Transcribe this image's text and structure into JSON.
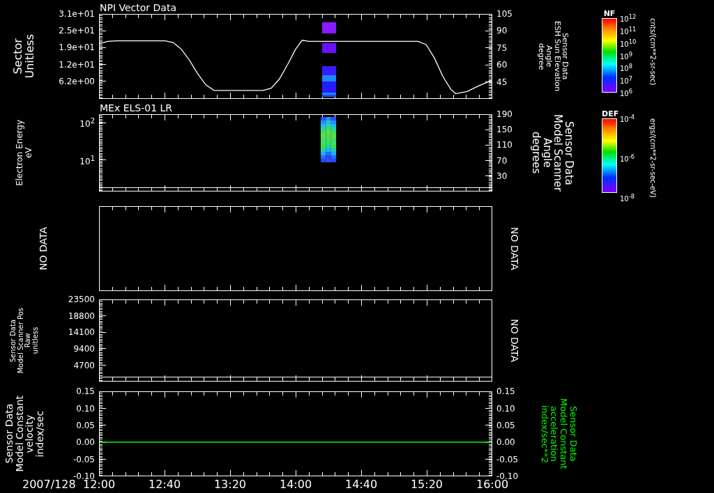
{
  "panels": [
    {
      "title": "NPI Vector Data",
      "kind": "line_spectrogram",
      "left_label": [
        "Sector",
        "Unitless"
      ],
      "left_ticks": [
        "3.1e+01",
        "2.5e+01",
        "1.9e+01",
        "1.2e+01",
        "6.2e+00"
      ],
      "right_label": [
        "Sensor Data",
        "ESH Sun Elevation",
        "Angle",
        "degree"
      ],
      "chart_data": {
        "type": "line",
        "xlim": [
          12,
          16
        ],
        "ylim": [
          30,
          105
        ],
        "yticks": [
          105,
          90,
          75,
          60,
          45
        ],
        "series": [
          {
            "color": "#ffffff",
            "values": [
              79,
              81,
              81.5,
              81.5,
              80,
              74,
              64,
              52,
              42,
              37,
              37,
              39,
              47,
              60,
              74,
              82,
              81,
              81,
              78,
              66,
              50,
              38,
              34,
              36,
              41,
              46
            ]
          }
        ],
        "x": [
          12,
          12.083,
          12.167,
          12.667,
          12.75,
          12.833,
          12.917,
          13,
          13.083,
          13.167,
          13.667,
          13.75,
          13.833,
          13.917,
          14,
          14.067,
          14.133,
          15.25,
          15.333,
          15.417,
          15.5,
          15.583,
          15.633,
          15.75,
          15.867,
          16
        ]
      }
    },
    {
      "title": "MEx ELS-01 LR",
      "kind": "spectrogram",
      "left_label": [
        "Electron Energy",
        "eV"
      ],
      "left_ticks": [
        "10$^{2}$",
        "10$^{1}$"
      ],
      "right_label": [
        "Sensor Data",
        "Model Scanner",
        "Angle",
        "degrees"
      ],
      "right_ticks": [
        "190",
        "150",
        "110",
        "70",
        "30"
      ]
    },
    {
      "kind": "empty",
      "left_label": [
        "NO DATA"
      ],
      "right_label": [
        "NO DATA"
      ]
    },
    {
      "kind": "flat",
      "left_label": [
        "Sensor Data",
        "Model Scanner Pos",
        "Raw",
        "unitless"
      ],
      "left_ticks": [
        "23500",
        "18800",
        "14100",
        "9400",
        "4700"
      ],
      "right_label": [
        "NO DATA"
      ]
    },
    {
      "kind": "line",
      "left_label": [
        "Sensor Data",
        "Model Constant",
        "velocity",
        "index/sec"
      ],
      "right_label": [
        "Sensor Data",
        "Model Constant",
        "acceleration",
        "index/sec**2"
      ],
      "right_ticks": [
        "0.15",
        "0.10",
        "0.05",
        "0.00",
        "-0.05",
        "-0.10"
      ],
      "chart_data": {
        "type": "line",
        "xlim": [
          12,
          16
        ],
        "ylim": [
          -0.1,
          0.15
        ],
        "yticks": [
          {
            "value": 0.15,
            "label": "0.15"
          },
          {
            "value": 0.1,
            "label": "0.10"
          },
          {
            "value": 0.05,
            "label": "0.05"
          },
          {
            "value": 0,
            "label": "0.00"
          },
          {
            "value": -0.05,
            "label": "-0.05"
          },
          {
            "value": -0.1,
            "label": "-0.10"
          }
        ],
        "xticks": [
          {
            "value": 12,
            "label": "12:00"
          },
          {
            "value": 12.667,
            "label": "12:40"
          },
          {
            "value": 13.333,
            "label": "13:20"
          },
          {
            "value": 14,
            "label": "14:00"
          },
          {
            "value": 14.667,
            "label": "14:40"
          },
          {
            "value": 15.333,
            "label": "15:20"
          },
          {
            "value": 16,
            "label": "16:00"
          }
        ],
        "series": [
          {
            "color": "#00ff00",
            "values": [
              0,
              0
            ]
          }
        ],
        "x": [
          12,
          16
        ]
      }
    }
  ],
  "x_axis": {
    "date": "2007/128"
  },
  "colorbars": [
    {
      "title": "NF",
      "ticks": [
        "10$^{12}$",
        "10$^{11}$",
        "10$^{10}$",
        "10$^{9}$",
        "10$^{8}$",
        "10$^{7}$",
        "10$^{6}$"
      ],
      "unit": "cnts/(cm**2-sr-sec)"
    },
    {
      "title": "DEF",
      "ticks": [
        "10$^{-4}$",
        "10$^{-6}$",
        "10$^{-8}$"
      ],
      "unit": "ergs/(cm**2-sr-sec-eV)"
    }
  ]
}
